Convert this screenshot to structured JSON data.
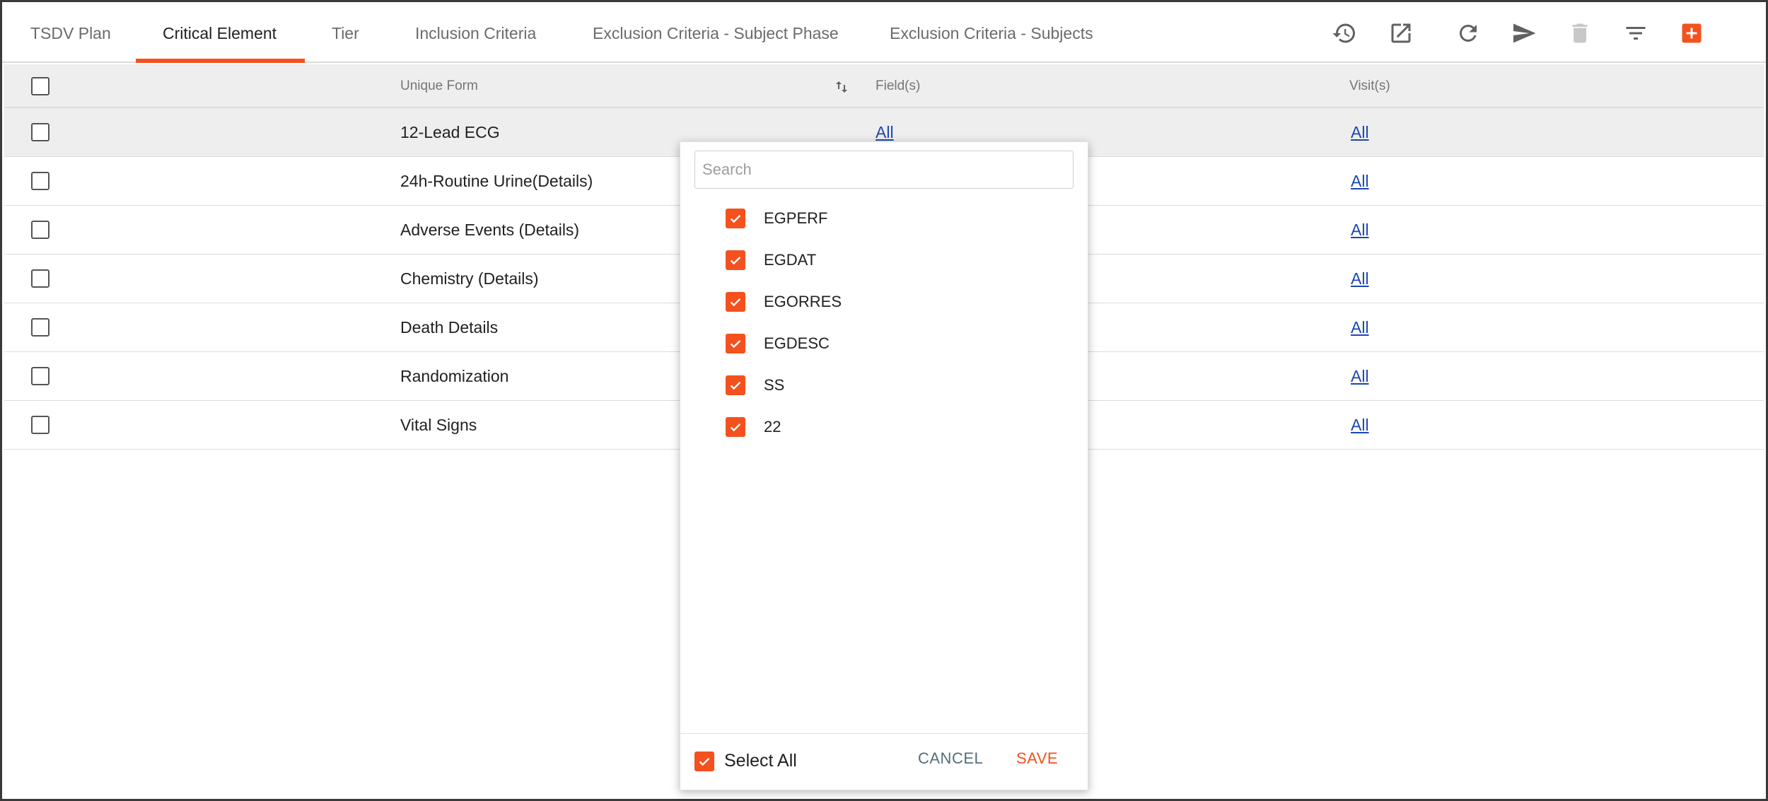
{
  "tabs": [
    {
      "label": "TSDV Plan"
    },
    {
      "label": "Critical Element"
    },
    {
      "label": "Tier"
    },
    {
      "label": "Inclusion Criteria"
    },
    {
      "label": "Exclusion Criteria - Subject Phase"
    },
    {
      "label": "Exclusion Criteria - Subjects"
    }
  ],
  "active_tab": "Critical Element",
  "toolbar": {
    "icons": [
      "history-icon",
      "open-external-icon",
      "refresh-icon",
      "send-icon",
      "delete-icon",
      "filter-icon",
      "add-icon"
    ],
    "accent_color": "#f4511e"
  },
  "table": {
    "headers": {
      "form": "Unique Form",
      "fields": "Field(s)",
      "visits": "Visit(s)"
    },
    "rows": [
      {
        "form": "12-Lead ECG",
        "fields": "All",
        "visits": "All"
      },
      {
        "form": "24h-Routine Urine(Details)",
        "fields": "",
        "visits": "All"
      },
      {
        "form": "Adverse Events (Details)",
        "fields": "",
        "visits": "All"
      },
      {
        "form": "Chemistry (Details)",
        "fields": "",
        "visits": "All"
      },
      {
        "form": "Death Details",
        "fields": "",
        "visits": "All"
      },
      {
        "form": "Randomization",
        "fields": "",
        "visits": "All"
      },
      {
        "form": "Vital Signs",
        "fields": "",
        "visits": "All"
      }
    ]
  },
  "dropdown": {
    "search_placeholder": "Search",
    "options": [
      {
        "label": "EGPERF",
        "checked": true
      },
      {
        "label": "EGDAT",
        "checked": true
      },
      {
        "label": "EGORRES",
        "checked": true
      },
      {
        "label": "EGDESC",
        "checked": true
      },
      {
        "label": "SS",
        "checked": true
      },
      {
        "label": "22",
        "checked": true
      }
    ],
    "select_all_label": "Select All",
    "select_all_checked": true,
    "cancel_label": "CANCEL",
    "save_label": "SAVE"
  }
}
